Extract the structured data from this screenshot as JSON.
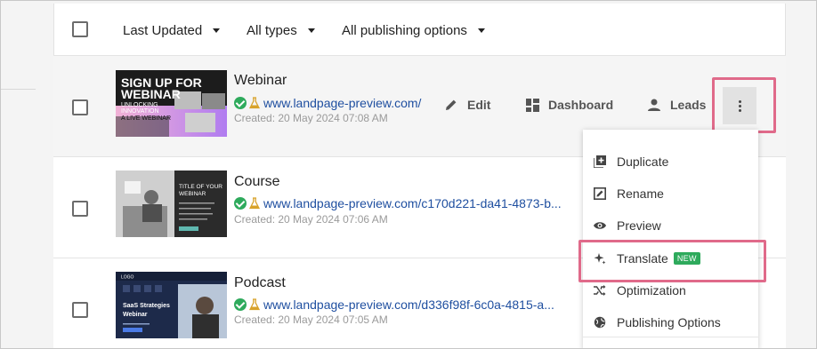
{
  "header": {
    "filters": [
      {
        "label": "Last Updated"
      },
      {
        "label": "All types"
      },
      {
        "label": "All publishing options"
      }
    ]
  },
  "rows": [
    {
      "title": "Webinar",
      "url": "www.landpage-preview.com/",
      "created": "Created: 20 May 2024 07:08 AM",
      "thumb_text": [
        "SIGN UP FOR",
        "WEBINAR",
        "UNLOCKING",
        "INNOVATION",
        "A LIVE WEBINAR"
      ]
    },
    {
      "title": "Course",
      "url": "www.landpage-preview.com/c170d221-da41-4873-b...",
      "created": "Created: 20 May 2024 07:06 AM",
      "thumb_text": [
        "TITLE OF YOUR",
        "WEBINAR"
      ]
    },
    {
      "title": "Podcast",
      "url": "www.landpage-preview.com/d336f98f-6c0a-4815-a...",
      "created": "Created: 20 May 2024 07:05 AM",
      "thumb_text": [
        "LOGO",
        "SaaS Strategies",
        "Webinar"
      ]
    }
  ],
  "actions": {
    "edit": "Edit",
    "dashboard": "Dashboard",
    "leads": "Leads"
  },
  "menu": {
    "duplicate": "Duplicate",
    "rename": "Rename",
    "preview": "Preview",
    "translate": "Translate",
    "translate_badge": "NEW",
    "optimization": "Optimization",
    "publishing_options": "Publishing Options"
  },
  "colors": {
    "link": "#1f4fa0",
    "success": "#2eaa5c",
    "highlight": "#e06a8a",
    "badge": "#2eaa5c"
  }
}
